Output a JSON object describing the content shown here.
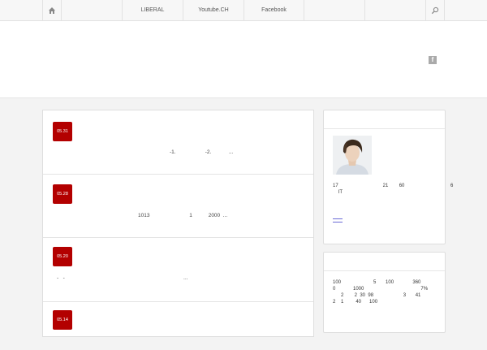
{
  "nav": {
    "home_icon": "home-icon",
    "items": [
      "LIBERAL",
      "Youtube.CH",
      "Facebook"
    ],
    "search_icon": "search-icon"
  },
  "header": {
    "facebook_icon": "facebook-icon",
    "facebook_glyph": "f"
  },
  "posts": [
    {
      "date": "05.31",
      "excerpt": "-1.                    -2.            ..."
    },
    {
      "date": "05.28",
      "excerpt": "1013                           1           2000  ..."
    },
    {
      "date": "05.20",
      "excerpt": "-   -                                                                                 ..."
    },
    {
      "date": "05.14",
      "excerpt": ""
    }
  ],
  "profile_widget": {
    "avatar_icon": "profile-photo",
    "line1": "17                                 21        60                                  6",
    "line2": "    IT"
  },
  "stats_widget": {
    "line1": "100                        5       100              360",
    "line2": "0             1000                                          7%",
    "line3": "      2        2  30  98                      3       41",
    "line4": "2    1         40      100"
  }
}
